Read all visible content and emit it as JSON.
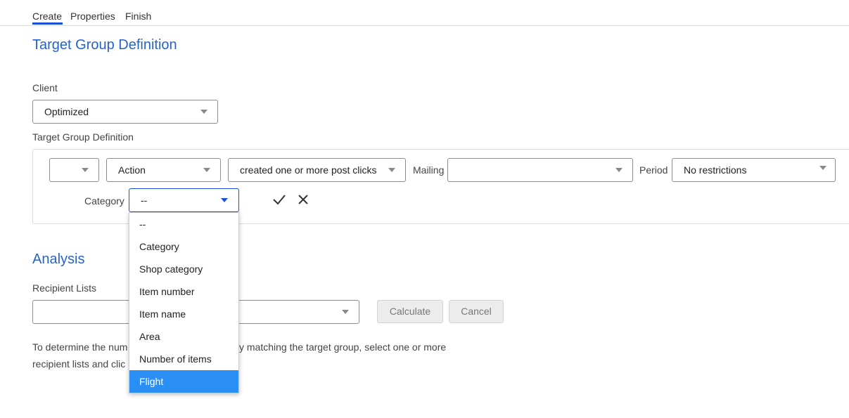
{
  "tabs": [
    {
      "label": "Create",
      "active": true
    },
    {
      "label": "Properties",
      "active": false
    },
    {
      "label": "Finish",
      "active": false
    }
  ],
  "page_title": "Target Group Definition",
  "client": {
    "label": "Client",
    "value": "Optimized"
  },
  "definition": {
    "label": "Target Group Definition",
    "operator_value": "",
    "type_value": "Action",
    "action_value": "created one or more post clicks",
    "mailing_label": "Mailing",
    "mailing_value": "",
    "period_label": "Period",
    "period_value": "No restrictions",
    "category_label": "Category",
    "category_value": "--",
    "category_options": [
      "--",
      "Category",
      "Shop category",
      "Item number",
      "Item name",
      "Area",
      "Number of items",
      "Flight"
    ],
    "highlighted_option": "Flight"
  },
  "analysis": {
    "title": "Analysis",
    "recipient_label": "Recipient Lists",
    "recipient_value": "",
    "calculate_label": "Calculate",
    "cancel_label": "Cancel",
    "help_line1_a": "To determine the num",
    "help_line1_b": "y matching the target group, select one or more",
    "help_line2_a": "recipient lists and clic"
  },
  "colors": {
    "accent": "#1a4fd8",
    "heading": "#2563c9",
    "highlight": "#2a8ff4"
  },
  "icons": [
    "check-icon",
    "close-icon",
    "chevron-down-icon"
  ]
}
